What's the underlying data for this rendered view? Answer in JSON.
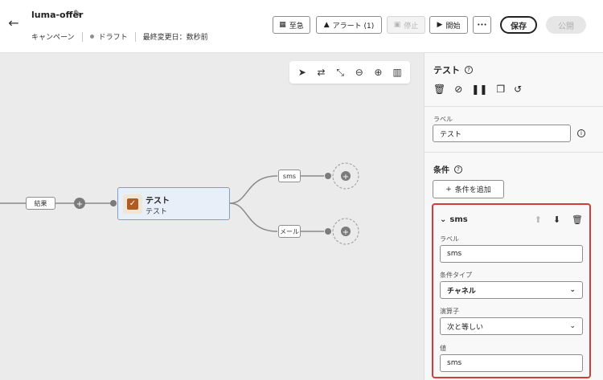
{
  "header": {
    "title": "luma-offer",
    "breadcrumb": "キャンペーン",
    "status": "ドラフト",
    "modified": "最終変更日：数秒前",
    "buttons": {
      "urgent": "至急",
      "alerts": "アラート (1)",
      "stop": "停止",
      "start": "開始",
      "more": "•••",
      "save": "保存",
      "publish": "公開"
    }
  },
  "canvas": {
    "node": {
      "title": "テスト",
      "subtitle": "テスト"
    },
    "input_label": "結果",
    "branches": [
      "sms",
      "メール"
    ]
  },
  "panel": {
    "title": "テスト",
    "label_field": {
      "label": "ラベル",
      "value": "テスト"
    },
    "conditions_title": "条件",
    "add_condition": "条件を追加",
    "condition": {
      "name": "sms",
      "label_field": {
        "label": "ラベル",
        "value": "sms"
      },
      "type_field": {
        "label": "条件タイプ",
        "value": "チャネル"
      },
      "operator_field": {
        "label": "演算子",
        "value": "次と等しい"
      },
      "value_field": {
        "label": "値",
        "value": "sms"
      }
    }
  }
}
